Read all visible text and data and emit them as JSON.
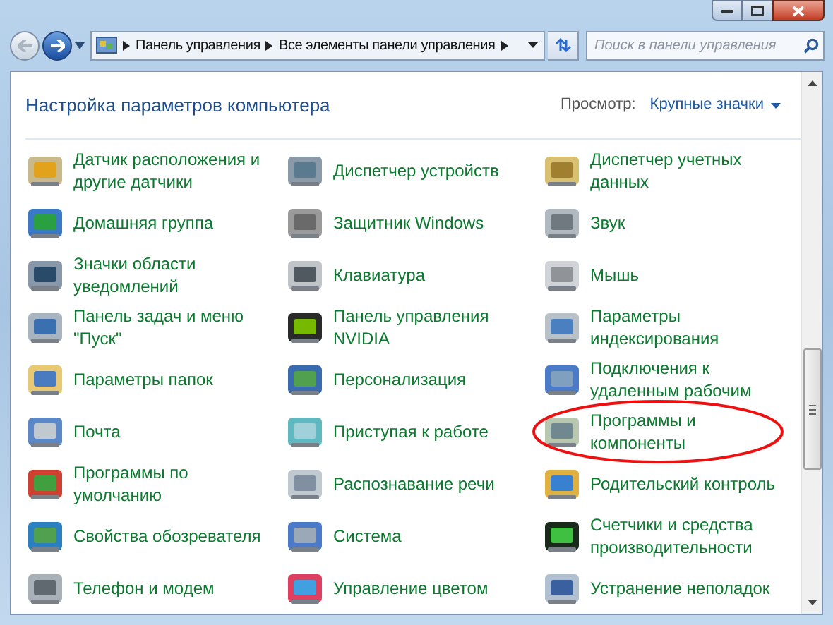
{
  "breadcrumb": [
    "Панель управления",
    "Все элементы панели управления"
  ],
  "search": {
    "placeholder": "Поиск в панели управления"
  },
  "heading": "Настройка параметров компьютера",
  "view": {
    "label": "Просмотр:",
    "value": "Крупные значки"
  },
  "items": [
    {
      "label": "Датчик расположения и другие датчики",
      "highlighted": false
    },
    {
      "label": "Диспетчер устройств",
      "highlighted": false
    },
    {
      "label": "Диспетчер учетных данных",
      "highlighted": false
    },
    {
      "label": "Домашняя группа",
      "highlighted": false
    },
    {
      "label": "Защитник Windows",
      "highlighted": false
    },
    {
      "label": "Звук",
      "highlighted": false
    },
    {
      "label": "Значки области уведомлений",
      "highlighted": false
    },
    {
      "label": "Клавиатура",
      "highlighted": false
    },
    {
      "label": "Мышь",
      "highlighted": false
    },
    {
      "label": "Панель задач и меню \"Пуск\"",
      "highlighted": false
    },
    {
      "label": "Панель управления NVIDIA",
      "highlighted": false
    },
    {
      "label": "Параметры индексирования",
      "highlighted": false
    },
    {
      "label": "Параметры папок",
      "highlighted": false
    },
    {
      "label": "Персонализация",
      "highlighted": false
    },
    {
      "label": "Подключения к удаленным рабочим",
      "highlighted": false
    },
    {
      "label": "Почта",
      "highlighted": false
    },
    {
      "label": "Приступая к работе",
      "highlighted": false
    },
    {
      "label": "Программы и компоненты",
      "highlighted": true
    },
    {
      "label": "Программы по умолчанию",
      "highlighted": false
    },
    {
      "label": "Распознавание речи",
      "highlighted": false
    },
    {
      "label": "Родительский контроль",
      "highlighted": false
    },
    {
      "label": "Свойства обозревателя",
      "highlighted": false
    },
    {
      "label": "Система",
      "highlighted": false
    },
    {
      "label": "Счетчики и средства производительности",
      "highlighted": false
    },
    {
      "label": "Телефон и модем",
      "highlighted": false
    },
    {
      "label": "Управление цветом",
      "highlighted": false
    },
    {
      "label": "Устранение неполадок",
      "highlighted": false
    }
  ]
}
